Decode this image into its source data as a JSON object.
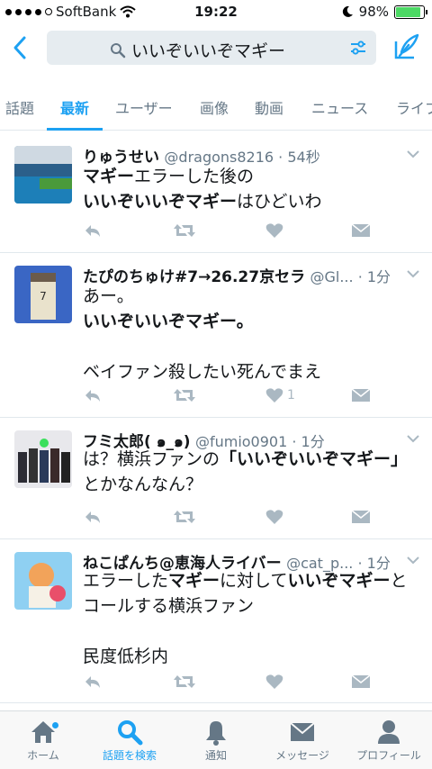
{
  "status": {
    "carrier": "SoftBank",
    "time": "19:22",
    "battery": "98%"
  },
  "search": {
    "query": "いいぞいいぞマギー"
  },
  "tabs": [
    "話題",
    "最新",
    "ユーザー",
    "画像",
    "動画",
    "ニュース",
    "ライブ"
  ],
  "tweets": [
    {
      "name": "りゅうせい",
      "handle": "@dragons8216",
      "time": "54秒",
      "lines": [
        [
          "マギー",
          "エラーした後の"
        ],
        [
          "いいぞいいぞマギー",
          "はひどいわ"
        ]
      ],
      "likes": ""
    },
    {
      "name": "たぴのちゅけ#7→26.27京セラ",
      "handle": "@Gl...",
      "time": "1分",
      "lines": [
        "あー。",
        "いいぞいいぞマギー。",
        "",
        "ベイファン殺したい死んでまえ"
      ],
      "likes": "1"
    },
    {
      "name": "フミ太郎( ๑_๑)",
      "handle": "@fumio0901",
      "time": "1分",
      "line1a": "は？横浜ファンの",
      "line1b": "「いいぞいいぞマギー」",
      "line2": "とかなんなん？",
      "likes": ""
    },
    {
      "name": "ねこぱんち@恵海人ライバー",
      "handle": "@cat_p...",
      "time": "1分",
      "line1a": "エラーした",
      "line1b": "マギー",
      "line1c": "に対して",
      "line1d": "いいぞマギー",
      "line1e": "と",
      "line2": "コールする横浜ファン",
      "line3": "民度低杉内",
      "likes": ""
    }
  ],
  "nav": [
    "ホーム",
    "話題を検索",
    "通知",
    "メッセージ",
    "プロフィール"
  ]
}
